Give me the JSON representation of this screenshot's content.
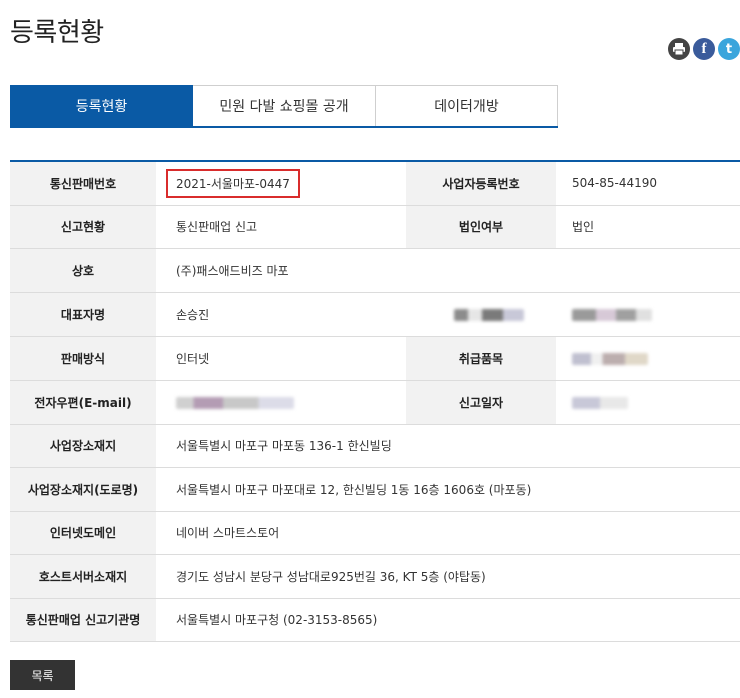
{
  "page": {
    "title": "등록현황"
  },
  "share": {
    "print_icon": "print-icon",
    "facebook_label": "f",
    "twitter_label": "t"
  },
  "tabs": [
    {
      "label": "등록현황",
      "active": true
    },
    {
      "label": "민원 다발 쇼핑몰 공개",
      "active": false
    },
    {
      "label": "데이터개방",
      "active": false
    }
  ],
  "table": {
    "rows": [
      {
        "h1": "통신판매번호",
        "v1": "2021-서울마포-0447",
        "h2": "사업자등록번호",
        "v2": "504-85-44190"
      },
      {
        "h1": "신고현황",
        "v1": "통신판매업 신고",
        "h2": "법인여부",
        "v2": "법인"
      },
      {
        "h1": "상호",
        "v1": "(주)패스애드비즈 마포"
      },
      {
        "h1": "대표자명",
        "v1": "손승진",
        "h2": "",
        "v2": ""
      },
      {
        "h1": "판매방식",
        "v1": "인터넷",
        "h2": "취급품목",
        "v2": ""
      },
      {
        "h1": "전자우편(E-mail)",
        "v1": "",
        "h2": "신고일자",
        "v2": ""
      },
      {
        "h1": "사업장소재지",
        "v1": "서울특별시 마포구 마포동 136-1 한신빌딩"
      },
      {
        "h1": "사업장소재지(도로명)",
        "v1": "서울특별시 마포구 마포대로 12, 한신빌딩 1동 16층 1606호 (마포동)"
      },
      {
        "h1": "인터넷도메인",
        "v1": "네이버 스마트스토어"
      },
      {
        "h1": "호스트서버소재지",
        "v1": "경기도 성남시 분당구 성남대로925번길 36, KT 5층 (야탑동)"
      },
      {
        "h1": "통신판매업 신고기관명",
        "v1": "서울특별시 마포구청 (02-3153-8565)"
      }
    ]
  },
  "footer": {
    "list_button": "목록"
  },
  "colors": {
    "accent": "#0a5aa5",
    "highlight": "#d92c2c"
  }
}
